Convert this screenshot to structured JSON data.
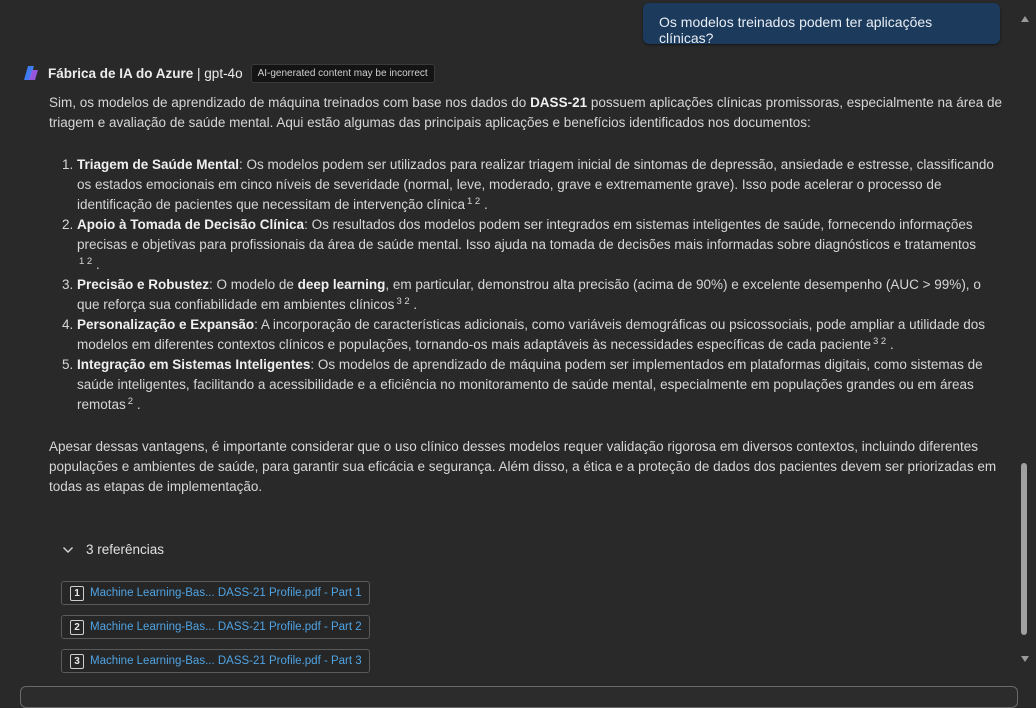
{
  "user_message": "Os modelos treinados podem ter aplicações clínicas?",
  "assistant": {
    "name": "Fábrica de IA do Azure",
    "separator": " | ",
    "model": "gpt-4o",
    "badge": "AI-generated content may be incorrect",
    "logo_icon": "azure-ai-foundry-logo",
    "intro": {
      "before": "Sim, os modelos de aprendizado de máquina treinados com base nos dados do ",
      "bold": "DASS-21",
      "after": " possuem aplicações clínicas promissoras, especialmente na área de triagem e avaliação de saúde mental. Aqui estão algumas das principais aplicações e benefícios identificados nos documentos:"
    },
    "items": [
      {
        "title": "Triagem de Saúde Mental",
        "text": ": Os modelos podem ser utilizados para realizar triagem inicial de sintomas de depressão, ansiedade e estresse, classificando os estados emocionais em cinco níveis de severidade (normal, leve, moderado, grave e extremamente grave). Isso pode acelerar o processo de identificação de pacientes que necessitam de intervenção clínica",
        "cite": "1 2",
        "end": "."
      },
      {
        "title": "Apoio à Tomada de Decisão Clínica",
        "text": ": Os resultados dos modelos podem ser integrados em sistemas inteligentes de saúde, fornecendo informações precisas e objetivas para profissionais da área de saúde mental. Isso ajuda na tomada de decisões mais informadas sobre diagnósticos e tratamentos",
        "cite": "1 2",
        "end": "."
      },
      {
        "title": "Precisão e Robustez",
        "text_a": ": O modelo de ",
        "bold2": "deep learning",
        "text": ", em particular, demonstrou alta precisão (acima de 90%) e excelente desempenho (AUC > 99%), o que reforça sua confiabilidade em ambientes clínicos",
        "cite": "3 2",
        "end": "."
      },
      {
        "title": "Personalização e Expansão",
        "text": ": A incorporação de características adicionais, como variáveis demográficas ou psicossociais, pode ampliar a utilidade dos modelos em diferentes contextos clínicos e populações, tornando-os mais adaptáveis às necessidades específicas de cada paciente",
        "cite": "3 2",
        "end": "."
      },
      {
        "title": "Integração em Sistemas Inteligentes",
        "text": ": Os modelos de aprendizado de máquina podem ser implementados em plataformas digitais, como sistemas de saúde inteligentes, facilitando a acessibilidade e a eficiência no monitoramento de saúde mental, especialmente em populações grandes ou em áreas remotas",
        "cite": "2",
        "end": "."
      }
    ],
    "closing": "Apesar dessas vantagens, é importante considerar que o uso clínico desses modelos requer validação rigorosa em diversos contextos, incluindo diferentes populações e ambientes de saúde, para garantir sua eficácia e segurança. Além disso, a ética e a proteção de dados dos pacientes devem ser priorizadas em todas as etapas de implementação."
  },
  "references": {
    "toggle_label": "3 referências",
    "toggle_icon": "chevron-down-icon",
    "items": [
      {
        "num": "1",
        "label": "Machine Learning-Bas... DASS-21 Profile.pdf - Part 1"
      },
      {
        "num": "2",
        "label": "Machine Learning-Bas... DASS-21 Profile.pdf - Part 2"
      },
      {
        "num": "3",
        "label": "Machine Learning-Bas... DASS-21 Profile.pdf - Part 3"
      }
    ]
  },
  "colors": {
    "background": "#292929",
    "user_bubble": "#1b3a5c",
    "link": "#4fa3e3",
    "text": "#d6d6d6"
  }
}
